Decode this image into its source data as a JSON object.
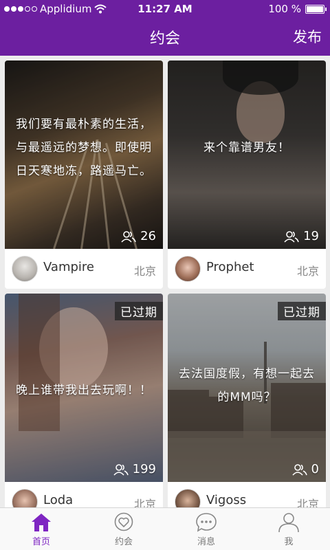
{
  "status_bar": {
    "carrier": "Applidium",
    "time": "11:27 AM",
    "battery": "100 %"
  },
  "nav": {
    "title": "约会",
    "action": "发布"
  },
  "cards": [
    {
      "text": "我们要有最朴素的生活，与最遥远的梦想。即使明日天寒地冻，路遥马亡。",
      "count": "26",
      "user": "Vampire",
      "city": "北京",
      "expired": ""
    },
    {
      "text": "来个靠谱男友！",
      "count": "19",
      "user": "Prophet",
      "city": "北京",
      "expired": ""
    },
    {
      "text": "晚上谁带我出去玩啊！！",
      "count": "199",
      "user": "Loda",
      "city": "北京",
      "expired": "已过期"
    },
    {
      "text": "去法国度假，有想一起去的MM吗？",
      "count": "0",
      "user": "Vigoss",
      "city": "北京",
      "expired": "已过期"
    }
  ],
  "tabs": [
    {
      "label": "首页",
      "icon": "home-icon",
      "active": true
    },
    {
      "label": "约会",
      "icon": "heart-bubble-icon",
      "active": false
    },
    {
      "label": "消息",
      "icon": "chat-bubble-icon",
      "active": false
    },
    {
      "label": "我",
      "icon": "person-icon",
      "active": false
    }
  ],
  "colors": {
    "accent": "#6c1fa0",
    "tab_active": "#7e25c2"
  }
}
